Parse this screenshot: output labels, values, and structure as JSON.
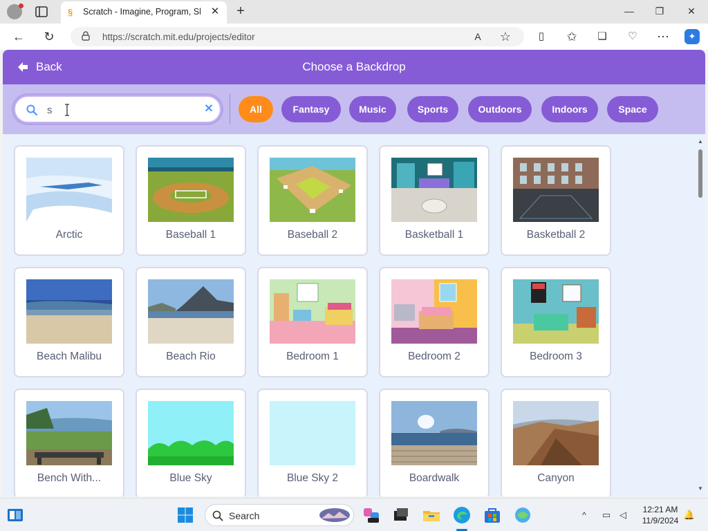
{
  "browser": {
    "tab_title": "Scratch - Imagine, Program, Share",
    "url": "https://scratch.mit.edu/projects/editor"
  },
  "modal": {
    "back_label": "Back",
    "title": "Choose a Backdrop",
    "search": {
      "value": "s"
    },
    "filters": [
      "All",
      "Fantasy",
      "Music",
      "Sports",
      "Outdoors",
      "Indoors",
      "Space"
    ],
    "active_filter": "All",
    "backdrops": [
      {
        "name": "Arctic",
        "art": "arctic"
      },
      {
        "name": "Baseball 1",
        "art": "baseball1"
      },
      {
        "name": "Baseball 2",
        "art": "baseball2"
      },
      {
        "name": "Basketball 1",
        "art": "basketball1"
      },
      {
        "name": "Basketball 2",
        "art": "basketball2"
      },
      {
        "name": "Beach Malibu",
        "art": "beach-malibu"
      },
      {
        "name": "Beach Rio",
        "art": "beach-rio"
      },
      {
        "name": "Bedroom 1",
        "art": "bedroom1"
      },
      {
        "name": "Bedroom 2",
        "art": "bedroom2"
      },
      {
        "name": "Bedroom 3",
        "art": "bedroom3"
      },
      {
        "name": "Bench With...",
        "art": "bench"
      },
      {
        "name": "Blue Sky",
        "art": "blue-sky"
      },
      {
        "name": "Blue Sky 2",
        "art": "blue-sky-2"
      },
      {
        "name": "Boardwalk",
        "art": "boardwalk"
      },
      {
        "name": "Canyon",
        "art": "canyon"
      }
    ]
  },
  "taskbar": {
    "search_label": "Search",
    "time": "12:21 AM",
    "date": "11/9/2024"
  },
  "colors": {
    "scratch_purple": "#855cd6",
    "active_chip": "#ff8c1a"
  }
}
